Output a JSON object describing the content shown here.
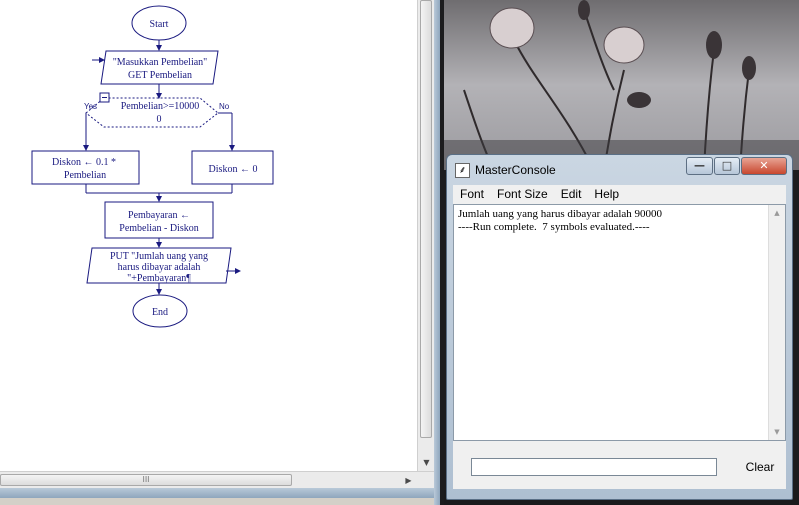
{
  "flowchart": {
    "start": "Start",
    "input_line1": "\"Masukkan Pembelian\"",
    "input_line2": "GET Pembelian",
    "decision_line1": "Pembelian>=10000",
    "decision_line2": "0",
    "yes_label": "Yes",
    "no_label": "No",
    "assign_yes_line1": "Diskon ← 0.1 *",
    "assign_yes_line2": "Pembelian",
    "assign_no": "Diskon ← 0",
    "payment_line1": "Pembayaran ←",
    "payment_line2": "Pembelian - Diskon",
    "output_line1": "PUT \"Jumlah uang yang",
    "output_line2": "harus dibayar adalah",
    "output_line3": "\"+Pembayaran¶",
    "end": "End",
    "hscroll_grip": "III",
    "color_stroke": "#1a1a80"
  },
  "console": {
    "title": "MasterConsole",
    "app_icon": "raptor-icon",
    "menu": [
      "Font",
      "Font Size",
      "Edit",
      "Help"
    ],
    "output_lines": [
      "Jumlah uang yang harus dibayar adalah 90000",
      "----Run complete.  7 symbols evaluated.----"
    ],
    "input_value": "",
    "clear_label": "Clear",
    "minimize_glyph": "—",
    "maximize_glyph": "□",
    "close_glyph": "✕"
  }
}
